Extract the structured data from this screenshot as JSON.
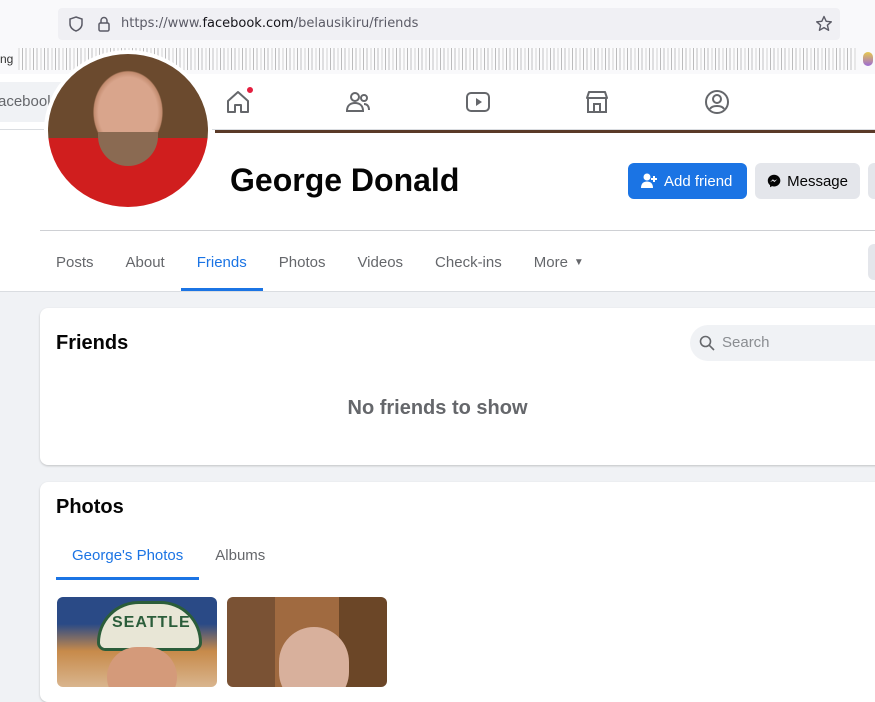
{
  "browser": {
    "url_prefix": "https://www.",
    "url_host": "facebook.com",
    "url_path": "/belausikiru/friends",
    "bookmark_fragment": "ng"
  },
  "topbar": {
    "search_placeholder": "acebook",
    "nav": [
      "home-icon",
      "friends-icon",
      "watch-icon",
      "marketplace-icon",
      "groups-icon"
    ]
  },
  "profile": {
    "name": "George Donald",
    "add_friend_label": "Add friend",
    "message_label": "Message"
  },
  "tabs": [
    {
      "label": "Posts"
    },
    {
      "label": "About"
    },
    {
      "label": "Friends",
      "active": true
    },
    {
      "label": "Photos"
    },
    {
      "label": "Videos"
    },
    {
      "label": "Check-ins"
    },
    {
      "label": "More"
    }
  ],
  "friends_card": {
    "title": "Friends",
    "search_placeholder": "Search",
    "empty_text": "No friends to show"
  },
  "photos_card": {
    "title": "Photos",
    "tabs": [
      {
        "label": "George's Photos",
        "active": true
      },
      {
        "label": "Albums"
      }
    ],
    "cap_text": "SEATTLE"
  },
  "colors": {
    "accent": "#1b74e4",
    "notification": "#e41e3f"
  }
}
